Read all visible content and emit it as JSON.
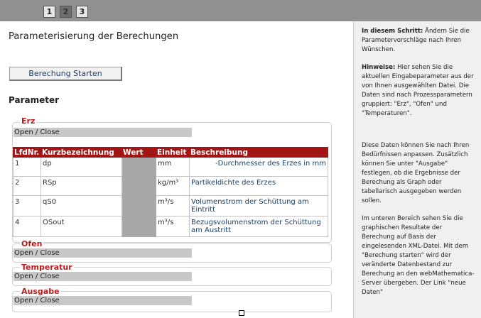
{
  "steps": [
    "1",
    "2",
    "3"
  ],
  "active_step": "2",
  "page": {
    "title": "Parameterisierung der Berechungen",
    "start_button": "Berechung Starten",
    "parameter_heading": "Parameter"
  },
  "groups": {
    "erz": {
      "title": "Erz",
      "toggle": "Open / Close"
    },
    "ofen": {
      "title": "Ofen",
      "toggle": "Open / Close"
    },
    "temperatur": {
      "title": "Temperatur",
      "toggle": "Open / Close"
    },
    "ausgabe": {
      "title": "Ausgabe",
      "toggle": "Open / Close"
    }
  },
  "table": {
    "headers": [
      "LfdNr.",
      "Kurzbezeichnung",
      "Wert",
      "Einheit",
      "Beschreibung"
    ],
    "rows": [
      {
        "nr": "1",
        "name": "dp",
        "unit": "mm",
        "desc": "-Durchmesser des Erzes in mm"
      },
      {
        "nr": "2",
        "name": "RSp",
        "unit": "kg/m³",
        "desc": "Partikeldichte des Erzes"
      },
      {
        "nr": "3",
        "name": "qS0",
        "unit": "m³/s",
        "desc": "Volumenstrom der Schüttung am Eintritt"
      },
      {
        "nr": "4",
        "name": "OSout",
        "unit": "m³/s",
        "desc": "Bezugsvolumenstrom der Schüttung am Austritt"
      }
    ]
  },
  "sidebar": {
    "p1_bold": "In diesem Schritt:",
    "p1_text": " Ändern Sie die Parametervorschläge nach Ihren Wünschen.",
    "p2_bold": "Hinweise:",
    "p2_text": " Hier sehen Sie die aktuellen Eingabeparameter aus der von Ihnen ausgewählten Datei. Die Daten sind nach Prozessparametern gruppiert: \"Erz\", \"Ofen\" und \"Temperaturen\".",
    "p3": "Diese Daten können Sie nach Ihren Bedürfnissen anpassen. Zusätzlich können Sie unter \"Ausgabe\" festlegen, ob die Ergebnisse der Berechung als Graph oder tabellarisch ausgegeben werden sollen.",
    "p4": "Im unteren Bereich sehen Sie die graphischen Resultate der Berechung auf Basis der eingelesenden XML-Datei. Mit dem \"Berechung starten\" wird der veränderte Datenbestand zur Berechung an den webMathematica-Server übergeben. Der Link \"neue Daten\""
  },
  "colors": {
    "header_red": "#a31515",
    "group_title_red": "#b71c1c",
    "topbar_gray": "#909090"
  }
}
